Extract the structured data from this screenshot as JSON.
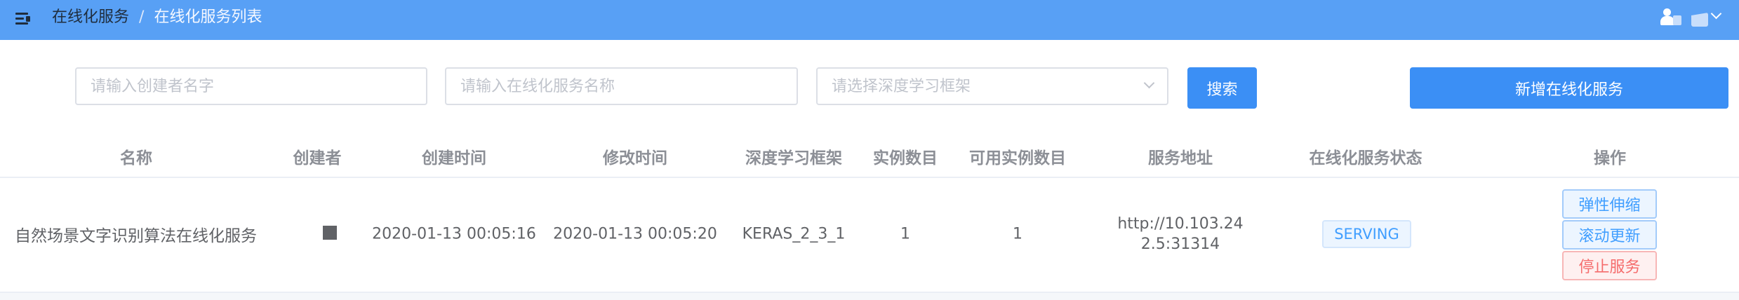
{
  "header": {
    "menu_icon": "menu-fold-icon",
    "breadcrumb": [
      "在线化服务",
      "在线化服务列表"
    ],
    "separator": "/",
    "user_icon": "user-icon",
    "dropdown_icon": "chevron-down-icon",
    "color": "#58a0f5"
  },
  "search": {
    "creator_placeholder": "请输入创建者名字",
    "service_name_placeholder": "请输入在线化服务名称",
    "framework_placeholder": "请选择深度学习框架",
    "search_button": "搜索",
    "add_button": "新增在线化服务"
  },
  "table": {
    "columns": [
      "名称",
      "创建者",
      "创建时间",
      "修改时间",
      "深度学习框架",
      "实例数目",
      "可用实例数目",
      "服务地址",
      "在线化服务状态",
      "操作"
    ],
    "rows": [
      {
        "name": "自然场景文字识别算法在线化服务",
        "creator": "",
        "created": "2020-01-13 00:05:16",
        "modified": "2020-01-13 00:05:20",
        "framework": "KERAS_2_3_1",
        "instances": "1",
        "available_instances": "1",
        "address": "http://10.103.242.5:31314",
        "status": "SERVING",
        "actions": [
          "弹性伸缩",
          "滚动更新",
          "停止服务"
        ]
      }
    ]
  },
  "colors": {
    "primary": "#3b8ff5",
    "tag_text": "#409eff",
    "danger": "#f56c6c"
  }
}
